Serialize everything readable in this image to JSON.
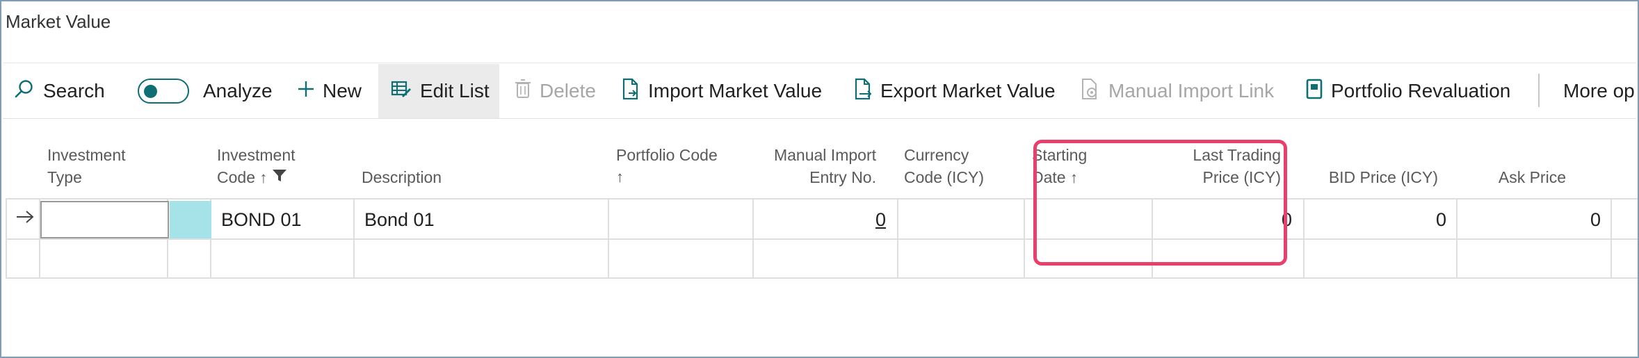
{
  "window": {
    "title": "Market Value"
  },
  "toolbar": {
    "search_label": "Search",
    "analyze_label": "Analyze",
    "analyze_toggle_on": true,
    "new_label": "New",
    "edit_list_label": "Edit List",
    "delete_label": "Delete",
    "import_label": "Import Market Value",
    "export_label": "Export Market Value",
    "manual_import_label": "Manual Import Link",
    "portfolio_reval_label": "Portfolio Revaluation",
    "more_options_label": "More op"
  },
  "grid": {
    "headers": {
      "investment_type": [
        "Investment",
        "Type"
      ],
      "investment_code": [
        "Investment",
        "Code"
      ],
      "description": "Description",
      "portfolio_code": "Portfolio Code",
      "manual_import_entry": [
        "Manual Import",
        "Entry No."
      ],
      "currency_code": [
        "Currency",
        "Code (ICY)"
      ],
      "starting_date": [
        "Starting",
        "Date"
      ],
      "last_trading_price": [
        "Last Trading",
        "Price (ICY)"
      ],
      "bid_price": "BID Price (ICY)",
      "ask_price": "Ask Price",
      "sort_arrow": "↑"
    },
    "rows": [
      {
        "investment_type": "",
        "investment_code": "BOND 01",
        "description": "Bond 01",
        "portfolio_code": "",
        "manual_import_entry": "0",
        "currency_code": "",
        "starting_date": "",
        "last_trading_price": "0",
        "bid_price": "0",
        "ask_price": "0"
      }
    ]
  },
  "colors": {
    "accent": "#0f6d74",
    "highlight": "#e8406a",
    "selected_cell": "#a6e3e8"
  }
}
